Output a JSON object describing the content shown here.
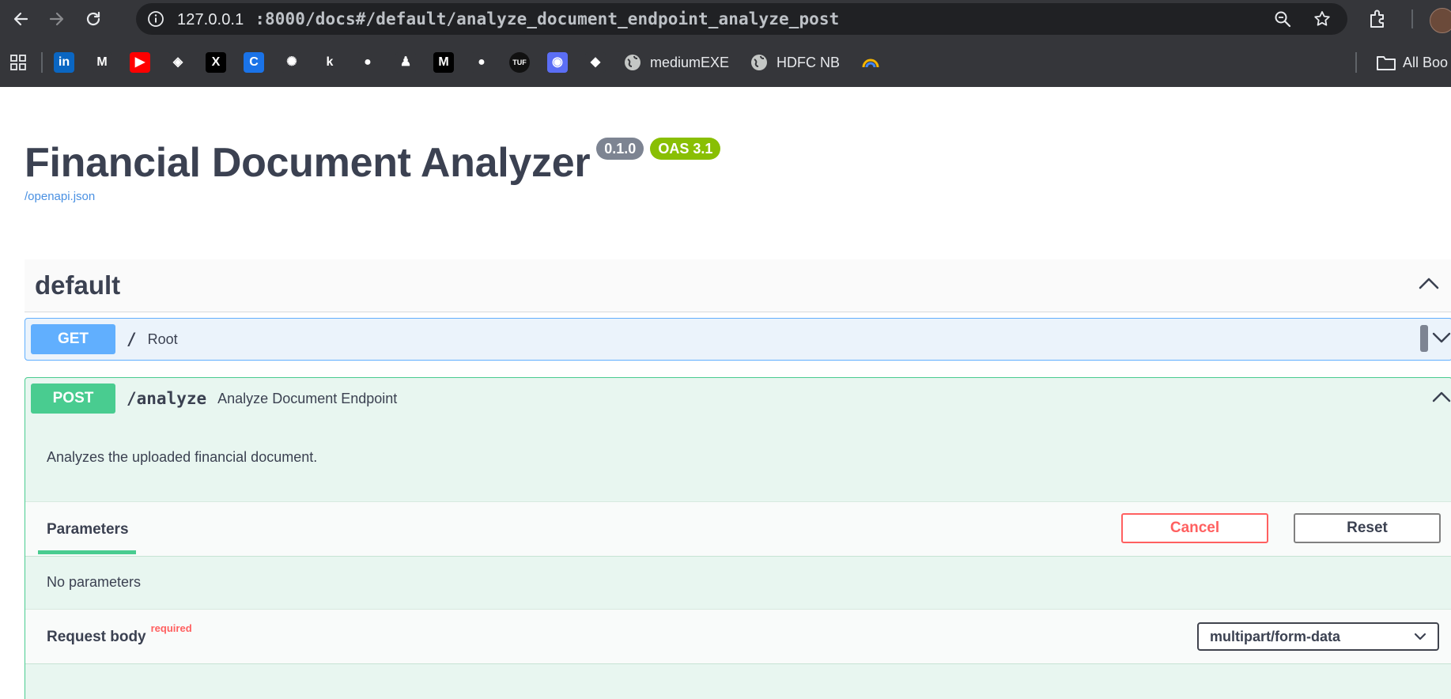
{
  "browser": {
    "url_host": "127.0.0.1",
    "url_path": ":8000/docs#/default/analyze_document_endpoint_analyze_post",
    "bookmarks": [
      {
        "icon": "linkedin-icon",
        "glyph": "in",
        "bg": "#0a66c2"
      },
      {
        "icon": "gmail-icon",
        "glyph": "M",
        "bg": "#35363a"
      },
      {
        "icon": "youtube-icon",
        "glyph": "▶",
        "bg": "#ff0000"
      },
      {
        "icon": "layers-icon",
        "glyph": "◈",
        "bg": "#35363a"
      },
      {
        "icon": "x-icon",
        "glyph": "X",
        "bg": "#000000"
      },
      {
        "icon": "c-icon",
        "glyph": "C",
        "bg": "#1a73e8"
      },
      {
        "icon": "openai-icon",
        "glyph": "✺",
        "bg": "#35363a"
      },
      {
        "icon": "k-icon",
        "glyph": "k",
        "bg": "#35363a"
      },
      {
        "icon": "github-icon",
        "glyph": "●",
        "bg": "#35363a"
      },
      {
        "icon": "chess-icon",
        "glyph": "♟",
        "bg": "#35363a"
      },
      {
        "icon": "medium-icon",
        "glyph": "M",
        "bg": "#000000"
      },
      {
        "icon": "github-icon",
        "glyph": "●",
        "bg": "#35363a"
      },
      {
        "icon": "tuf-icon",
        "glyph": "TUF",
        "bg": "#111111"
      },
      {
        "icon": "app-icon",
        "glyph": "◉",
        "bg": "#5b6ef5"
      },
      {
        "icon": "fish-icon",
        "glyph": "◆",
        "bg": "#35363a"
      }
    ],
    "bookmark_mediumexe": "mediumEXE",
    "bookmark_hdfc": "HDFC NB",
    "bookmark_all": "All Boo"
  },
  "page": {
    "title": "Financial Document Analyzer",
    "version": "0.1.0",
    "oas": "OAS 3.1",
    "openapi_link": "/openapi.json",
    "tag": "default",
    "operations": {
      "get": {
        "method": "GET",
        "path": "/",
        "summary": "Root"
      },
      "post": {
        "method": "POST",
        "path": "/analyze",
        "summary": "Analyze Document Endpoint",
        "description": "Analyzes the uploaded financial document.",
        "params_tab": "Parameters",
        "cancel_label": "Cancel",
        "reset_label": "Reset",
        "no_params": "No parameters",
        "request_body_label": "Request body",
        "required_flag": "required",
        "content_type": "multipart/form-data"
      }
    }
  },
  "colors": {
    "get": "#61affe",
    "post": "#49cc90",
    "cancel": "#ff6060",
    "version_badge": "#7d8492",
    "oas_badge": "#89bf04"
  }
}
